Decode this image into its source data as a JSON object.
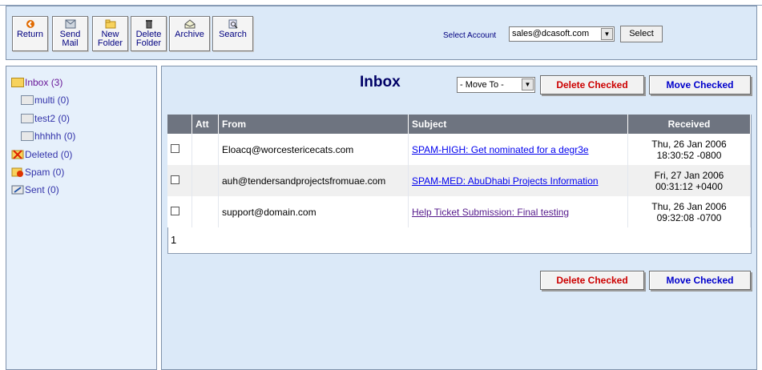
{
  "toolbar": {
    "buttons": [
      {
        "label": "Return",
        "icon": "return-icon"
      },
      {
        "label": "Send\nMail",
        "icon": "send-mail-icon"
      },
      {
        "label": "New\nFolder",
        "icon": "new-folder-icon"
      },
      {
        "label": "Delete\nFolder",
        "icon": "delete-folder-icon"
      },
      {
        "label": "Archive",
        "icon": "archive-icon"
      },
      {
        "label": "Search",
        "icon": "search-icon"
      }
    ],
    "account_label": "Select Account",
    "account_value": "sales@dcasoft.com",
    "select_button": "Select"
  },
  "sidebar": {
    "folders": [
      {
        "label": "Inbox (3)",
        "icon": "inbox-icon"
      },
      {
        "label": "multi (0)",
        "icon": "folder-icon"
      },
      {
        "label": "test2 (0)",
        "icon": "folder-icon"
      },
      {
        "label": "hhhhh (0)",
        "icon": "folder-icon"
      },
      {
        "label": "Deleted (0)",
        "icon": "deleted-icon"
      },
      {
        "label": "Spam (0)",
        "icon": "spam-icon"
      },
      {
        "label": "Sent (0)",
        "icon": "sent-icon"
      }
    ]
  },
  "main": {
    "title": "Inbox",
    "move_to": "- Move To -",
    "delete_checked": "Delete Checked",
    "move_checked": "Move Checked",
    "columns": [
      "Att",
      "From",
      "Subject",
      "Received"
    ],
    "messages": [
      {
        "from": "Eloacq@worcestericecats.com",
        "subject": "SPAM-HIGH: Get nominated for a degr3e",
        "received_date": "Thu, 26 Jan 2006",
        "received_time": "18:30:52 -0800"
      },
      {
        "from": "auh@tendersandprojectsfromuae.com",
        "subject": "SPAM-MED: AbuDhabi Projects Information",
        "received_date": "Fri, 27 Jan 2006",
        "received_time": "00:31:12 +0400"
      },
      {
        "from": "support@domain.com",
        "subject": "Help Ticket Submission: Final testing",
        "received_date": "Thu, 26 Jan 2006",
        "received_time": "09:32:08 -0700"
      }
    ],
    "page": "1"
  }
}
